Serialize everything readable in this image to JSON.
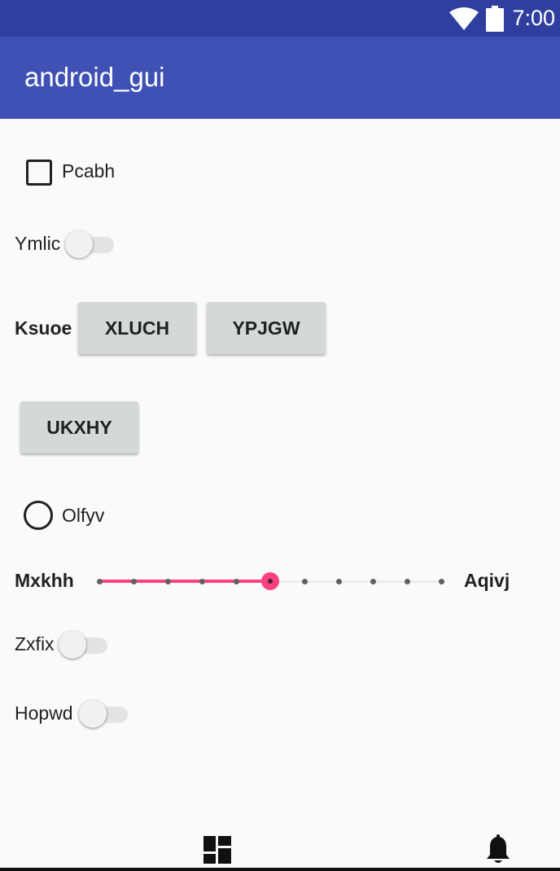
{
  "status_bar": {
    "time": "7:00",
    "wifi_icon": "wifi-icon",
    "battery_icon": "battery-icon"
  },
  "app_bar": {
    "title": "android_gui"
  },
  "content": {
    "checkbox": {
      "label": "Pcabh",
      "checked": false
    },
    "switch_1": {
      "label": "Ymlic",
      "on": false
    },
    "button_row": {
      "label": "Ksuoe",
      "buttons": [
        "XLUCH",
        "YPJGW"
      ]
    },
    "button_single": "UKXHY",
    "radio": {
      "label": "Olfyv",
      "selected": false
    },
    "seekbar": {
      "start_label": "Mxkhh",
      "end_label": "Aqivj",
      "min": 0,
      "max": 10,
      "value": 5
    },
    "switch_2": {
      "label": "Zxfix",
      "on": false
    },
    "switch_3": {
      "label": "Hopwd",
      "on": false
    }
  },
  "bottom_nav": {
    "items": [
      {
        "icon": "dashboard-icon"
      },
      {
        "icon": "notifications-icon"
      }
    ]
  },
  "colors": {
    "status_bar": "#303f9f",
    "app_bar": "#3f51b5",
    "accent": "#ff4081",
    "background": "#fafafa"
  }
}
